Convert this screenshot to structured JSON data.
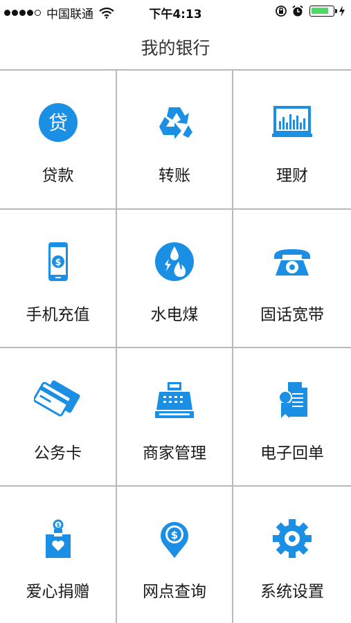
{
  "status_bar": {
    "carrier": "中国联通",
    "time": "下午4:13"
  },
  "nav": {
    "title": "我的银行"
  },
  "theme": {
    "accent": "#1a8fe3"
  },
  "menu": [
    {
      "label": "贷款",
      "icon": "loan-icon",
      "glyph": "贷"
    },
    {
      "label": "转账",
      "icon": "recycle-transfer-icon"
    },
    {
      "label": "理财",
      "icon": "finance-chart-icon"
    },
    {
      "label": "手机充值",
      "icon": "mobile-topup-icon"
    },
    {
      "label": "水电煤",
      "icon": "utilities-icon"
    },
    {
      "label": "固话宽带",
      "icon": "telephone-icon"
    },
    {
      "label": "公务卡",
      "icon": "business-card-icon"
    },
    {
      "label": "商家管理",
      "icon": "cash-register-icon"
    },
    {
      "label": "电子回单",
      "icon": "e-receipt-icon"
    },
    {
      "label": "爱心捐赠",
      "icon": "donation-box-icon"
    },
    {
      "label": "网点查询",
      "icon": "branch-locator-icon"
    },
    {
      "label": "系统设置",
      "icon": "settings-gear-icon"
    }
  ]
}
